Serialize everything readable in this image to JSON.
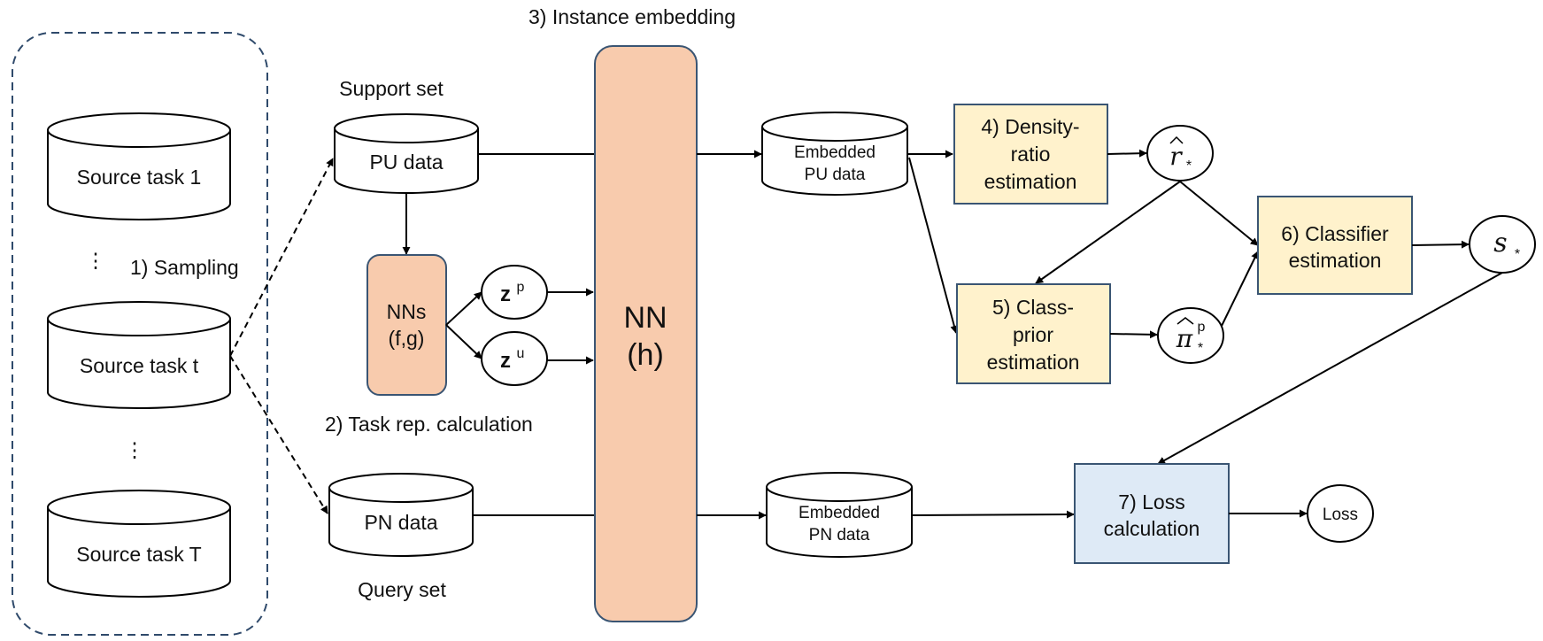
{
  "title": "Meta-learning pipeline for PU classification",
  "colors": {
    "nn_fill": "#f8cbad",
    "estimation_fill": "#fff2cc",
    "loss_fill": "#deeaf6",
    "box_stroke": "#3a5573",
    "dashed_stroke": "#2f4a6b"
  },
  "source_tasks": {
    "items": [
      "Source task 1",
      "Source task t",
      "Source task T"
    ],
    "ellipsis": "⋮"
  },
  "steps": {
    "sampling": "1) Sampling",
    "task_rep": "2) Task rep. calculation",
    "instance_embedding": "3) Instance embedding",
    "density_ratio": [
      "4) Density-",
      "ratio",
      "estimation"
    ],
    "class_prior": [
      "5) Class-",
      "prior",
      "estimation"
    ],
    "classifier": [
      "6) Classifier",
      "estimation"
    ],
    "loss_calc": [
      "7) Loss",
      "calculation"
    ]
  },
  "sets": {
    "support_label": "Support set",
    "query_label": "Query set",
    "pu_data": "PU data",
    "pn_data": "PN data",
    "embedded_pu": [
      "Embedded",
      "PU data"
    ],
    "embedded_pn": [
      "Embedded",
      "PN data"
    ]
  },
  "networks": {
    "task_nn": [
      "NNs",
      "(f,g)"
    ],
    "instance_nn": [
      "NN",
      "(h)"
    ]
  },
  "variables": {
    "zp": {
      "base": "z",
      "sup": "p"
    },
    "zu": {
      "base": "z",
      "sup": "u"
    },
    "r_hat": {
      "base": "r",
      "sub": "*"
    },
    "pi_hat": {
      "base": "π",
      "sub": "*",
      "sup": "p"
    },
    "s_star": {
      "base": "s",
      "sub": "*"
    },
    "loss": "Loss"
  }
}
